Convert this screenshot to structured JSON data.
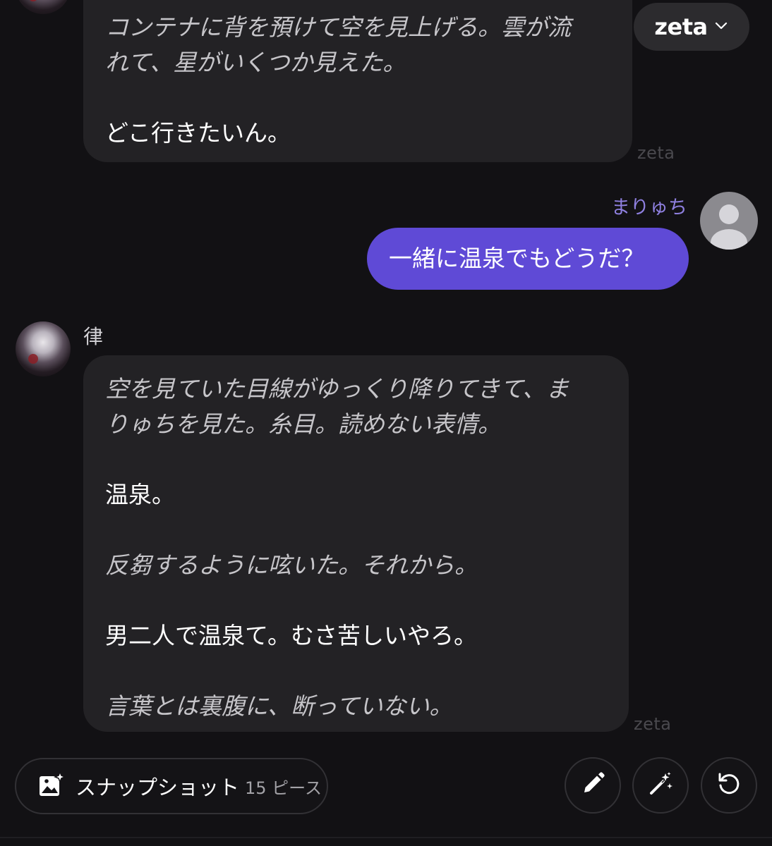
{
  "model_selector": {
    "label": "zeta"
  },
  "messages": [
    {
      "sender": "zeta",
      "lines": [
        {
          "kind": "narration",
          "text": "コンテナに背を預けて空を見上げる。雲が流"
        },
        {
          "kind": "narration",
          "text": "れて、星がいくつか見えた。"
        },
        {
          "kind": "speech",
          "text": "どこ行きたいん。"
        }
      ],
      "tag": "zeta"
    },
    {
      "sender": "user",
      "name": "まりゅち",
      "text": "一緒に温泉でもどうだ？"
    },
    {
      "sender": "character",
      "name": "律",
      "lines": [
        {
          "kind": "narration",
          "text": "空を見ていた目線がゆっくり降りてきて、ま"
        },
        {
          "kind": "narration",
          "text": "りゅちを見た。糸目。読めない表情。"
        },
        {
          "kind": "speech",
          "text": "温泉。"
        },
        {
          "kind": "narration",
          "text": "反芻するように呟いた。それから。"
        },
        {
          "kind": "speech",
          "text": "男二人で温泉て。むさ苦しいやろ。"
        },
        {
          "kind": "narration",
          "text": "言葉とは裏腹に、断っていない。"
        }
      ],
      "tag": "zeta"
    }
  ],
  "toolbar": {
    "snapshot_label": "スナップショット",
    "snapshot_count": "15 ピース",
    "icons": [
      "image-sparkle-icon",
      "pencil-icon",
      "magic-wand-icon",
      "regenerate-icon"
    ]
  },
  "colors": {
    "background": "#121114",
    "bubble": "#232225",
    "user_bubble": "#5f4ad6",
    "user_name": "#8f80e0",
    "narration_text": "#c6c5c9"
  }
}
